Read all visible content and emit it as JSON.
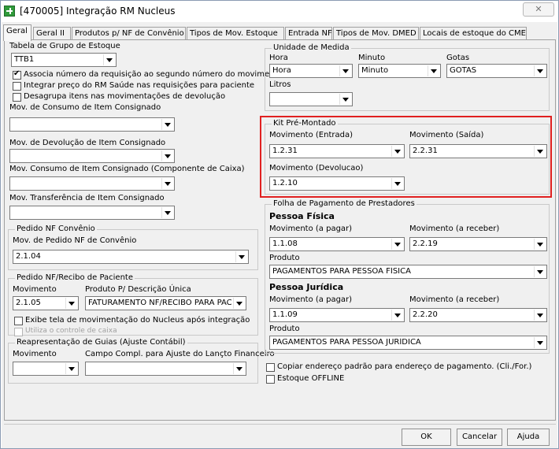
{
  "window": {
    "title": "[470005]  Integração RM Nucleus",
    "close_label": "✕"
  },
  "tabs": [
    "Geral",
    "Geral II",
    "Produtos p/ NF de Convênio",
    "Tipos de Mov. Estoque",
    "Entrada NF",
    "Tipos de Mov. DMED",
    "Locais de estoque do CME"
  ],
  "left": {
    "tabela_label": "Tabela de Grupo de Estoque",
    "tabela_value": "TTB1",
    "chk_associa": {
      "label": "Associa número da requisição ao segundo número do movimento",
      "checked": true
    },
    "chk_integrar": {
      "label": "Integrar preço do RM Saúde nas requisições para paciente",
      "checked": false
    },
    "chk_desagrupa": {
      "label": "Desagrupa itens nas movimentações de  devolução",
      "checked": false
    },
    "consumo_label": "Mov. de Consumo de Item Consignado",
    "consumo_value": "",
    "devolucao_label": "Mov. de Devolução de Item Consignado",
    "devolucao_value": "",
    "consumo_comp_label": "Mov. Consumo de Item Consignado (Componente de Caixa)",
    "consumo_comp_value": "",
    "transf_label": "Mov. Transferência de Item Consignado",
    "transf_value": "",
    "pedido_conv": {
      "title": "Pedido NF Convênio",
      "label": "Mov. de Pedido NF de Convênio",
      "value": "2.1.04"
    },
    "pedido_rec": {
      "title": "Pedido NF/Recibo de Paciente",
      "mov_label": "Movimento",
      "mov_value": "2.1.05",
      "prod_label": "Produto P/ Descrição Única",
      "prod_value": "FATURAMENTO NF/RECIBO PARA PAC",
      "chk_exibe": "Exibe tela de movimentação do Nucleus após integração",
      "chk_caixa": "Utiliza o controle de caixa"
    },
    "reapres": {
      "title": "Reapresentação de Guias (Ajuste Contábil)",
      "mov_label": "Movimento",
      "mov_value": "",
      "campo_label": "Campo Compl. para Ajuste do Lançto Financeiro",
      "campo_value": ""
    }
  },
  "right": {
    "unidade": {
      "title": "Unidade de Medida",
      "hora_label": "Hora",
      "hora_value": "Hora",
      "minuto_label": "Minuto",
      "minuto_value": "Minuto",
      "gotas_label": "Gotas",
      "gotas_value": "GOTAS",
      "litros_label": "Litros",
      "litros_value": ""
    },
    "kit": {
      "title": "Kit Pré-Montado",
      "entrada_label": "Movimento (Entrada)",
      "entrada_value": "1.2.31",
      "saida_label": "Movimento (Saída)",
      "saida_value": "2.2.31",
      "devol_label": "Movimento (Devolucao)",
      "devol_value": "1.2.10"
    },
    "folha": {
      "title": "Folha de Pagamento de Prestadores",
      "pf_title": "Pessoa Física",
      "pf_pagar_label": "Movimento (a pagar)",
      "pf_pagar_value": "1.1.08",
      "pf_receber_label": "Movimento (a receber)",
      "pf_receber_value": "2.2.19",
      "pf_prod_label": "Produto",
      "pf_prod_value": "PAGAMENTOS PARA PESSOA FÍSICA",
      "pj_title": "Pessoa Jurídica",
      "pj_pagar_label": "Movimento (a pagar)",
      "pj_pagar_value": "1.1.09",
      "pj_receber_label": "Movimento (a receber)",
      "pj_receber_value": "2.2.20",
      "pj_prod_label": "Produto",
      "pj_prod_value": "PAGAMENTOS PARA PESSOA JURÍDICA"
    },
    "chk_copiar": "Copiar endereço padrão para endereço de pagamento. (Cli./For.)",
    "chk_offline": "Estoque OFFLINE"
  },
  "buttons": {
    "ok": "OK",
    "cancelar": "Cancelar",
    "ajuda": "Ajuda"
  },
  "colors": {
    "highlight": "#e02020"
  }
}
